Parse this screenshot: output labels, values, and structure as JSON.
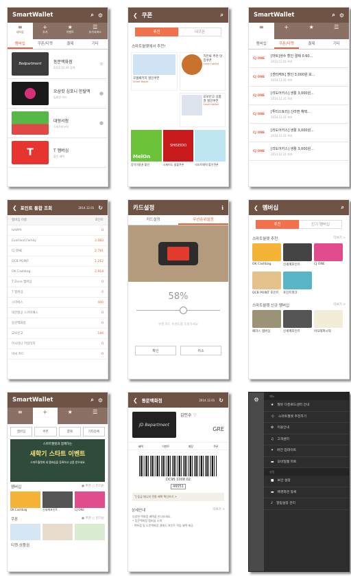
{
  "s1": {
    "title": "SmartWallet",
    "nav": [
      "≡",
      "+",
      "★",
      "☰"
    ],
    "nav_labels": [
      "내지갑",
      "추가",
      "이벤트",
      "부가서비스"
    ],
    "tabs": [
      "멤버십",
      "쿠폰/티켓",
      "결제",
      "기타"
    ],
    "items": [
      {
        "name": "동문백화점",
        "sub": "2015.10.06 등록",
        "card_text": "Bedpartment"
      },
      {
        "name": "오삼핫 심포니 한탈맥",
        "sub": "등록한 카드",
        "card_text": "Black"
      },
      {
        "name": "대형서점",
        "sub": "스마트바우처",
        "card_text": ""
      },
      {
        "name": "T 멤버십",
        "sub": "할인 혜택",
        "card_text": "T"
      }
    ]
  },
  "s2": {
    "title": "쿠폰",
    "seg": [
      "추천",
      "내쿠폰"
    ],
    "banner": "스마트월렛에서 추천!",
    "cards": [
      {
        "name": "호텔패키지 할인쿠폰",
        "sub": "Smart Wallet"
      },
      {
        "name": "치킨류 추천 맛집쿠폰",
        "sub": "Smart Wallet"
      },
      {
        "name": "교보문고 상품권 할인쿠폰",
        "sub": "Smart Wallet"
      },
      {
        "name": "MelOn",
        "sub": "음악이용권 할인",
        "tag": "MelOn"
      },
      {
        "name": "SHISEIDO",
        "sub": "시세이도 샘플쿠폰",
        "tag": "SHISEIDO"
      },
      {
        "name": "리조트매직 할인쿠폰",
        "sub": "Smart Wallet"
      }
    ]
  },
  "s3": {
    "title": "SmartWallet",
    "tabs": [
      "멤버십",
      "쿠폰/티켓",
      "결제",
      "기타"
    ],
    "brand": "CJ ONE",
    "items": [
      {
        "name": "[마트]생수 할인 결제 0.60...",
        "sub": "2014.12.01 까지"
      },
      {
        "name": "[센터케트] 할인 3,000원 보...",
        "sub": "2014.12.31 까지"
      },
      {
        "name": "[리도어키스] 생활 3,000원...",
        "sub": "2014.12.31 까지"
      },
      {
        "name": "[투티스토리] 신라면 혜택...",
        "sub": "2014.12.31 까지"
      },
      {
        "name": "[리도어키스] 생활 3,000원...",
        "sub": "2014.12.31 까지"
      },
      {
        "name": "[리도어키스] 생활 3,000원...",
        "sub": "2014.12.31 까지"
      }
    ]
  },
  "s4": {
    "title": "포인트 통합 조회",
    "date": "2014.12.01",
    "col_left": "멤버십 이름",
    "col_right": "포인트",
    "rows": [
      {
        "k": "HAPPY",
        "v": "0"
      },
      {
        "k": "Everland Family",
        "v": "2,083"
      },
      {
        "k": "CJ ONE",
        "v": "2,781"
      },
      {
        "k": "OCB POINT",
        "v": "1,212"
      },
      {
        "k": "OK Cashbag",
        "v": "2,918"
      },
      {
        "k": "T Zone 멤버십",
        "v": "0"
      },
      {
        "k": "T 멤버십",
        "v": "0"
      },
      {
        "k": "스타벅스",
        "v": "440"
      },
      {
        "k": "대한항공 스카이패스",
        "v": "0"
      },
      {
        "k": "동문백화점",
        "v": "0"
      },
      {
        "k": "교보문고",
        "v": "184"
      },
      {
        "k": "아시아나 마일리지",
        "v": "0"
      },
      {
        "k": "비씨 카드",
        "v": "0"
      }
    ]
  },
  "s5": {
    "title": "카드설정",
    "tabs": [
      "카드설정",
      "우선순위설정"
    ],
    "percent": "58%",
    "percent_value": 0.58,
    "hint": "위젯 카드 투명도를 조절하세요",
    "ok": "확인",
    "cancel": "취소"
  },
  "s6": {
    "title": "멤버십",
    "seg": [
      "추천",
      "인기 멤버십"
    ],
    "sec1": "스마트월렛 추천",
    "sec2": "스마트월렛 신규 멤버십",
    "more": "더보기 >",
    "cards1": [
      "OK Cashbag",
      "신세계포인트",
      "CJ ONE",
      "OCB POINT 포인트",
      "포인트파크"
    ],
    "cards2": [
      "페라스 멤버십",
      "신세계포인트",
      "아모레퍼시픽"
    ]
  },
  "s7": {
    "title": "SmartWallet",
    "tabs": [
      "멤버십",
      "쿠폰",
      "결제",
      "기타등록"
    ],
    "banner_top": "스마트월렛과 함께하는",
    "banner_big": "새학기 스타트 이벤트",
    "banner_sub": "스마트월렛에 새 멤버십을 등록하고 상품 받으세요",
    "sec1": "멤버십",
    "sec2": "쿠폰",
    "sec3": "티켓·상품권",
    "opts": [
      "● 추천",
      "○ 인기순"
    ],
    "cards1": [
      "OK Cashbag",
      "신세계포인트",
      "CJ ONE"
    ]
  },
  "s8": {
    "title": "동문백화점",
    "date": "2014.12.01",
    "owner": "김민수",
    "card_brand": "JD Bepartment",
    "grade": "GRE",
    "barcode_no": "DC95 1008 02",
    "short_code": "46051",
    "promo": "“J 등급 매니저 전용 혜택 확인하기 >",
    "notice_title": "상세안내",
    "notice_more": "더보기 >",
    "notice1": "다양한 백화점 혜택을 만나보세요.",
    "notice2": "• 동문백화점 멤버십 소개",
    "notice3": "- 백화점 및 도문백화점 결제시 포인트 적립 혜택 제공",
    "tabs": [
      "혜택",
      "이벤트",
      "매장",
      "쿠폰"
    ]
  },
  "s9": {
    "sec1": "메뉴",
    "sec2": "설정",
    "items": [
      {
        "i": "★",
        "t": "월릿 다운로드센터 안내"
      },
      {
        "i": "➕",
        "t": "스마트월렛 추천하기"
      },
      {
        "i": "⚙",
        "t": "이용안내"
      },
      {
        "i": "♫",
        "t": "고객센터"
      },
      {
        "i": "✦",
        "t": "버전 업데이트"
      },
      {
        "i": "▬",
        "t": "모바일웹 파트"
      }
    ],
    "items2": [
      {
        "i": "■",
        "t": "보안 설정"
      },
      {
        "i": "▬",
        "t": "배경화면 등록"
      },
      {
        "i": "♪",
        "t": "알림설정 관리"
      }
    ]
  }
}
